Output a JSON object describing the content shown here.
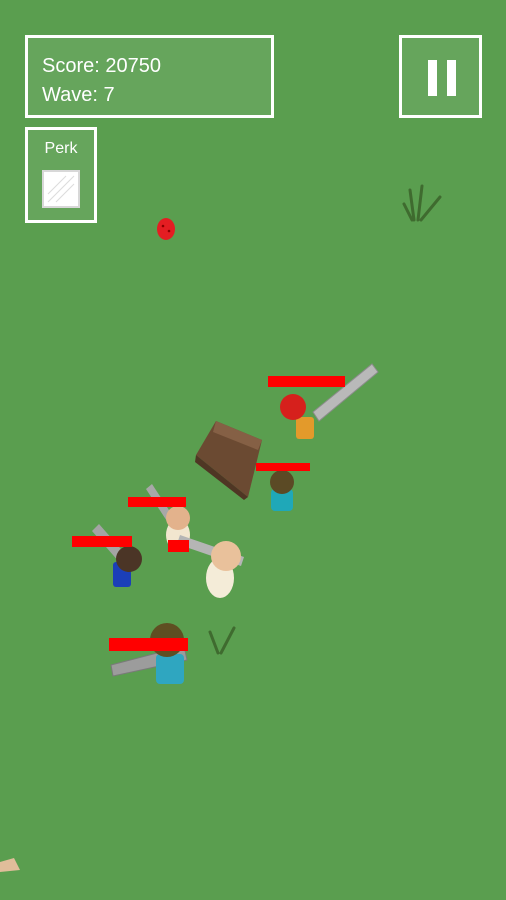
{
  "hud": {
    "score_label": "Score:",
    "score_value": "20750",
    "wave_label": "Wave:",
    "wave_value": "7"
  },
  "perk": {
    "label": "Perk"
  },
  "colors": {
    "grass": "#5a9e4f",
    "health_bar": "#ff0000",
    "hud_border": "#ffffff",
    "crate": "#6b4a32"
  },
  "icons": {
    "pause": "pause-icon",
    "perk_slot": "perk-slot-icon"
  }
}
